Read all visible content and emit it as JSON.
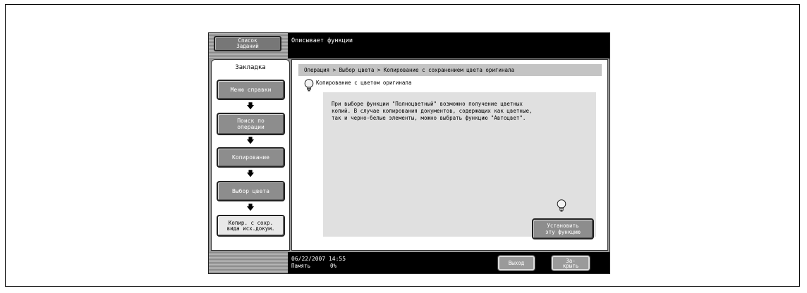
{
  "header": {
    "job_list_label": "Список\nЗаданий",
    "message": "Описывает функции"
  },
  "sidebar": {
    "tab_title": "Закладка",
    "items": [
      {
        "label": "Меню справки"
      },
      {
        "label": "Поиск по\nоперации"
      },
      {
        "label": "Копирование"
      },
      {
        "label": "Выбор цвета"
      },
      {
        "label": "Копир. с сохр.\nвида исх.докум."
      }
    ],
    "arrow": "🡇"
  },
  "main": {
    "breadcrumb": "Операция > Выбор цвета > Копирование с сохранением цвета оригинала",
    "section_title": "Копирование с цветом оригинала",
    "description": "При выборе функции \"Полноцветный\" возможно получение цветных\nкопий. В случае копирования документов, содержащих как цветные,\nтак и черно-белые элементы, можно выбрать функцию \"Автоцвет\".",
    "set_function_label": "Установить\nэту функцию"
  },
  "footer": {
    "datetime": "06/22/2007   14:55",
    "memory_label": "Память",
    "memory_value": "0%",
    "exit_label": "Выход",
    "close_label": "За-\nкрыть"
  },
  "icons": {
    "bulb": "lightbulb-icon",
    "arrow": "arrow-down-icon"
  }
}
